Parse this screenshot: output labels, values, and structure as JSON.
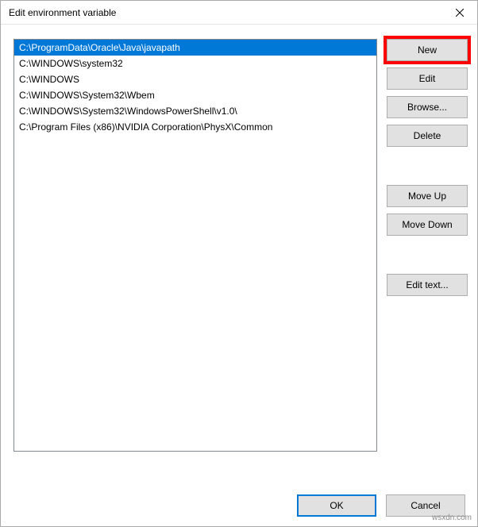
{
  "titlebar": {
    "title": "Edit environment variable"
  },
  "list": {
    "items": [
      {
        "path": "C:\\ProgramData\\Oracle\\Java\\javapath",
        "selected": true
      },
      {
        "path": "C:\\WINDOWS\\system32",
        "selected": false
      },
      {
        "path": "C:\\WINDOWS",
        "selected": false
      },
      {
        "path": "C:\\WINDOWS\\System32\\Wbem",
        "selected": false
      },
      {
        "path": "C:\\WINDOWS\\System32\\WindowsPowerShell\\v1.0\\",
        "selected": false
      },
      {
        "path": "C:\\Program Files (x86)\\NVIDIA Corporation\\PhysX\\Common",
        "selected": false
      }
    ]
  },
  "buttons": {
    "new": "New",
    "edit": "Edit",
    "browse": "Browse...",
    "delete": "Delete",
    "move_up": "Move Up",
    "move_down": "Move Down",
    "edit_text": "Edit text...",
    "ok": "OK",
    "cancel": "Cancel"
  },
  "watermark": "wsxdn.com"
}
